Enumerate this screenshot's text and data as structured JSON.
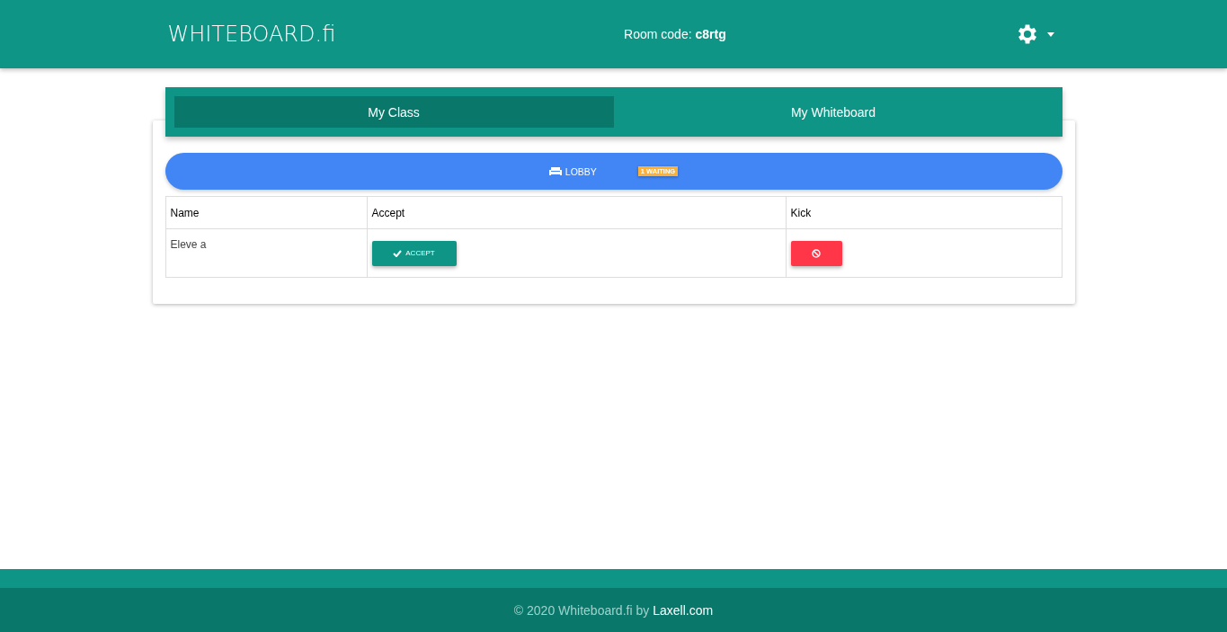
{
  "header": {
    "logo": "WHITEBOARD.fi",
    "room_code": "Room code: **c8rtg**"
  },
  "tabs": [
    {
      "label": "My Class",
      "selected": true
    },
    {
      "label": "My Whiteboard",
      "selected": false
    }
  ],
  "lobby": {
    "label": "LOBBY",
    "badge": "1 WAITING"
  },
  "table": {
    "columns": [
      "Name",
      "Accept",
      "Kick"
    ],
    "rows": [
      {
        "name": "Eleve a",
        "accept": "ACCEPT"
      }
    ]
  },
  "footer": {
    "text": "© 2020 Whiteboard.fi by",
    "link": "Laxell.com"
  }
}
